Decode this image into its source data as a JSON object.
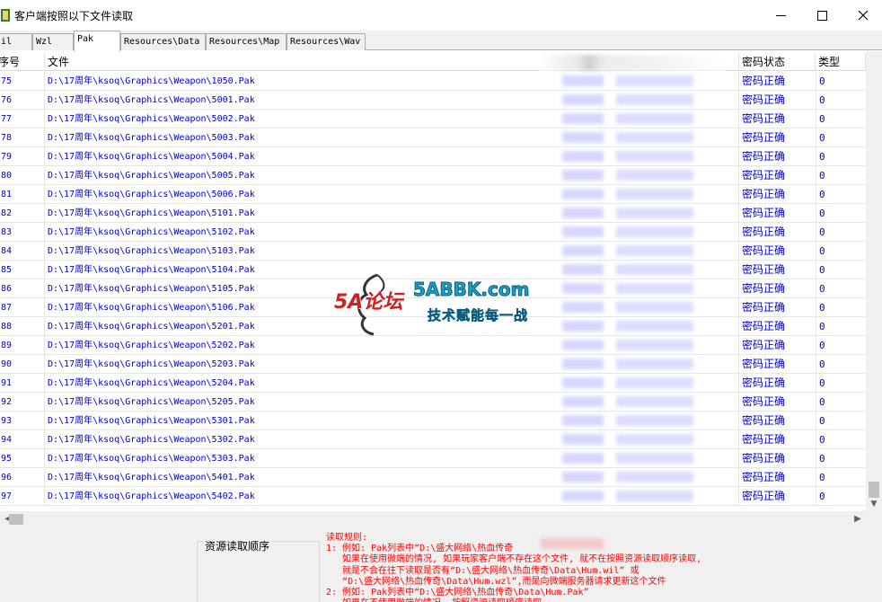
{
  "window": {
    "title": "客户端按照以下文件读取"
  },
  "tabs": [
    {
      "label": "il"
    },
    {
      "label": "Wzl"
    },
    {
      "label": "Pak",
      "active": true
    },
    {
      "label": "Resources\\Data"
    },
    {
      "label": "Resources\\Map"
    },
    {
      "label": "Resources\\Wav"
    }
  ],
  "table": {
    "columns": {
      "no": "序号",
      "file": "文件",
      "status": "密码状态",
      "type": "类型"
    },
    "rows": [
      {
        "no": "75",
        "file": "D:\\17周年\\ksoq\\Graphics\\Weapon\\1050.Pak",
        "status": "密码正确",
        "type": "0"
      },
      {
        "no": "76",
        "file": "D:\\17周年\\ksoq\\Graphics\\Weapon\\5001.Pak",
        "status": "密码正确",
        "type": "0"
      },
      {
        "no": "77",
        "file": "D:\\17周年\\ksoq\\Graphics\\Weapon\\5002.Pak",
        "status": "密码正确",
        "type": "0"
      },
      {
        "no": "78",
        "file": "D:\\17周年\\ksoq\\Graphics\\Weapon\\5003.Pak",
        "status": "密码正确",
        "type": "0"
      },
      {
        "no": "79",
        "file": "D:\\17周年\\ksoq\\Graphics\\Weapon\\5004.Pak",
        "status": "密码正确",
        "type": "0"
      },
      {
        "no": "80",
        "file": "D:\\17周年\\ksoq\\Graphics\\Weapon\\5005.Pak",
        "status": "密码正确",
        "type": "0"
      },
      {
        "no": "81",
        "file": "D:\\17周年\\ksoq\\Graphics\\Weapon\\5006.Pak",
        "status": "密码正确",
        "type": "0"
      },
      {
        "no": "82",
        "file": "D:\\17周年\\ksoq\\Graphics\\Weapon\\5101.Pak",
        "status": "密码正确",
        "type": "0"
      },
      {
        "no": "83",
        "file": "D:\\17周年\\ksoq\\Graphics\\Weapon\\5102.Pak",
        "status": "密码正确",
        "type": "0"
      },
      {
        "no": "84",
        "file": "D:\\17周年\\ksoq\\Graphics\\Weapon\\5103.Pak",
        "status": "密码正确",
        "type": "0"
      },
      {
        "no": "85",
        "file": "D:\\17周年\\ksoq\\Graphics\\Weapon\\5104.Pak",
        "status": "密码正确",
        "type": "0"
      },
      {
        "no": "86",
        "file": "D:\\17周年\\ksoq\\Graphics\\Weapon\\5105.Pak",
        "status": "密码正确",
        "type": "0"
      },
      {
        "no": "87",
        "file": "D:\\17周年\\ksoq\\Graphics\\Weapon\\5106.Pak",
        "status": "密码正确",
        "type": "0"
      },
      {
        "no": "88",
        "file": "D:\\17周年\\ksoq\\Graphics\\Weapon\\5201.Pak",
        "status": "密码正确",
        "type": "0"
      },
      {
        "no": "89",
        "file": "D:\\17周年\\ksoq\\Graphics\\Weapon\\5202.Pak",
        "status": "密码正确",
        "type": "0"
      },
      {
        "no": "90",
        "file": "D:\\17周年\\ksoq\\Graphics\\Weapon\\5203.Pak",
        "status": "密码正确",
        "type": "0"
      },
      {
        "no": "91",
        "file": "D:\\17周年\\ksoq\\Graphics\\Weapon\\5204.Pak",
        "status": "密码正确",
        "type": "0"
      },
      {
        "no": "92",
        "file": "D:\\17周年\\ksoq\\Graphics\\Weapon\\5205.Pak",
        "status": "密码正确",
        "type": "0"
      },
      {
        "no": "93",
        "file": "D:\\17周年\\ksoq\\Graphics\\Weapon\\5301.Pak",
        "status": "密码正确",
        "type": "0"
      },
      {
        "no": "94",
        "file": "D:\\17周年\\ksoq\\Graphics\\Weapon\\5302.Pak",
        "status": "密码正确",
        "type": "0"
      },
      {
        "no": "95",
        "file": "D:\\17周年\\ksoq\\Graphics\\Weapon\\5303.Pak",
        "status": "密码正确",
        "type": "0"
      },
      {
        "no": "96",
        "file": "D:\\17周年\\ksoq\\Graphics\\Weapon\\5401.Pak",
        "status": "密码正确",
        "type": "0"
      },
      {
        "no": "97",
        "file": "D:\\17周年\\ksoq\\Graphics\\Weapon\\5402.Pak",
        "status": "密码正确",
        "type": "0"
      }
    ]
  },
  "bottom": {
    "group_label": "资源读取顺序",
    "rules_lines": [
      "读取规则:",
      "1: 例如: Pak列表中“D:\\盛大网络\\热血传奇",
      "   如果在使用微端的情况, 如果玩家客户端不存在这个文件, 就不在按照资源读取顺序读取,",
      "   就是不会在往下读取是否有“D:\\盛大网络\\热血传奇\\Data\\Hum.wil” 或",
      "   “D:\\盛大网络\\热血传奇\\Data\\Hum.wzl”,而是向微端服务器请求更新这个文件",
      "2: 例如: Pak列表中“D:\\盛大网络\\热血传奇\\Data\\Hum.Pak”",
      "   如果在不使用微端的情况, 按照资源读取顺序读取"
    ]
  },
  "watermark": {
    "brand": "5A论坛",
    "site": "5ABBK.com",
    "slogan": "技术赋能每一战"
  },
  "colors": {
    "row_text": "#0000c8",
    "rules_text": "#ff0000",
    "watermark_red": "#d02020",
    "watermark_blue": "#1aa0c8"
  }
}
